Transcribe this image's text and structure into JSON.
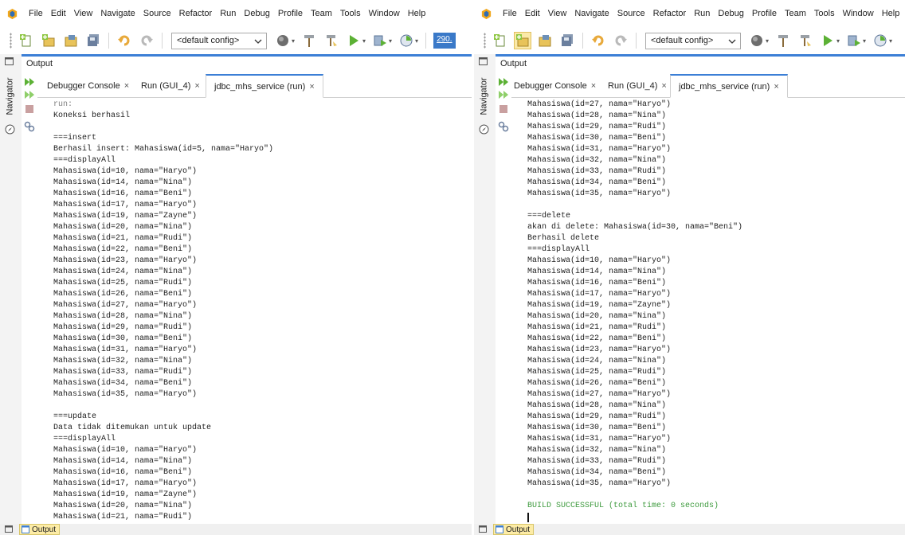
{
  "menubar": {
    "items": [
      "File",
      "Edit",
      "View",
      "Navigate",
      "Source",
      "Refactor",
      "Run",
      "Debug",
      "Profile",
      "Team",
      "Tools",
      "Window",
      "Help"
    ]
  },
  "toolbar": {
    "config_select": "<default config>",
    "memory_label": "290."
  },
  "sidebar": {
    "navigator_label": "Navigator"
  },
  "output": {
    "title": "Output"
  },
  "tabs": {
    "debugger_console": "Debugger Console",
    "run_gui": "Run (GUI_4)",
    "jdbc_service": "jdbc_mhs_service (run)",
    "close_glyph": "×"
  },
  "statusbar": {
    "output_label": "Output"
  },
  "left_console": [
    "run:",
    "Koneksi berhasil",
    "",
    "===insert",
    "Berhasil insert: Mahasiswa(id=5, nama=\"Haryo\")",
    "===displayAll",
    "Mahasiswa(id=10, nama=\"Haryo\")",
    "Mahasiswa(id=14, nama=\"Nina\")",
    "Mahasiswa(id=16, nama=\"Beni\")",
    "Mahasiswa(id=17, nama=\"Haryo\")",
    "Mahasiswa(id=19, nama=\"Zayne\")",
    "Mahasiswa(id=20, nama=\"Nina\")",
    "Mahasiswa(id=21, nama=\"Rudi\")",
    "Mahasiswa(id=22, nama=\"Beni\")",
    "Mahasiswa(id=23, nama=\"Haryo\")",
    "Mahasiswa(id=24, nama=\"Nina\")",
    "Mahasiswa(id=25, nama=\"Rudi\")",
    "Mahasiswa(id=26, nama=\"Beni\")",
    "Mahasiswa(id=27, nama=\"Haryo\")",
    "Mahasiswa(id=28, nama=\"Nina\")",
    "Mahasiswa(id=29, nama=\"Rudi\")",
    "Mahasiswa(id=30, nama=\"Beni\")",
    "Mahasiswa(id=31, nama=\"Haryo\")",
    "Mahasiswa(id=32, nama=\"Nina\")",
    "Mahasiswa(id=33, nama=\"Rudi\")",
    "Mahasiswa(id=34, nama=\"Beni\")",
    "Mahasiswa(id=35, nama=\"Haryo\")",
    "",
    "===update",
    "Data tidak ditemukan untuk update",
    "===displayAll",
    "Mahasiswa(id=10, nama=\"Haryo\")",
    "Mahasiswa(id=14, nama=\"Nina\")",
    "Mahasiswa(id=16, nama=\"Beni\")",
    "Mahasiswa(id=17, nama=\"Haryo\")",
    "Mahasiswa(id=19, nama=\"Zayne\")",
    "Mahasiswa(id=20, nama=\"Nina\")",
    "Mahasiswa(id=21, nama=\"Rudi\")"
  ],
  "right_console": [
    "Mahasiswa(id=27, nama=\"Haryo\")",
    "Mahasiswa(id=28, nama=\"Nina\")",
    "Mahasiswa(id=29, nama=\"Rudi\")",
    "Mahasiswa(id=30, nama=\"Beni\")",
    "Mahasiswa(id=31, nama=\"Haryo\")",
    "Mahasiswa(id=32, nama=\"Nina\")",
    "Mahasiswa(id=33, nama=\"Rudi\")",
    "Mahasiswa(id=34, nama=\"Beni\")",
    "Mahasiswa(id=35, nama=\"Haryo\")",
    "",
    "===delete",
    "akan di delete: Mahasiswa(id=30, nama=\"Beni\")",
    "Berhasil delete",
    "===displayAll",
    "Mahasiswa(id=10, nama=\"Haryo\")",
    "Mahasiswa(id=14, nama=\"Nina\")",
    "Mahasiswa(id=16, nama=\"Beni\")",
    "Mahasiswa(id=17, nama=\"Haryo\")",
    "Mahasiswa(id=19, nama=\"Zayne\")",
    "Mahasiswa(id=20, nama=\"Nina\")",
    "Mahasiswa(id=21, nama=\"Rudi\")",
    "Mahasiswa(id=22, nama=\"Beni\")",
    "Mahasiswa(id=23, nama=\"Haryo\")",
    "Mahasiswa(id=24, nama=\"Nina\")",
    "Mahasiswa(id=25, nama=\"Rudi\")",
    "Mahasiswa(id=26, nama=\"Beni\")",
    "Mahasiswa(id=27, nama=\"Haryo\")",
    "Mahasiswa(id=28, nama=\"Nina\")",
    "Mahasiswa(id=29, nama=\"Rudi\")",
    "Mahasiswa(id=30, nama=\"Beni\")",
    "Mahasiswa(id=31, nama=\"Haryo\")",
    "Mahasiswa(id=32, nama=\"Nina\")",
    "Mahasiswa(id=33, nama=\"Rudi\")",
    "Mahasiswa(id=34, nama=\"Beni\")",
    "Mahasiswa(id=35, nama=\"Haryo\")",
    "",
    "BUILD SUCCESSFUL (total time: 0 seconds)"
  ],
  "colors": {
    "accent_blue": "#3c7fd6",
    "build_success_green": "#3d9a3d",
    "run_gray": "#808080",
    "status_tab_yellow": "#fdeca6"
  },
  "icons": [
    "netbeans-logo-icon",
    "new-file-icon",
    "new-project-icon",
    "open-project-icon",
    "save-all-icon",
    "undo-icon",
    "redo-icon",
    "chevron-down-icon",
    "globe-icon",
    "hammer-icon",
    "clean-build-icon",
    "run-icon",
    "debug-icon",
    "profile-icon",
    "rerun-icon",
    "stop-icon",
    "settings-icon",
    "navigator-icon",
    "restore-window-icon",
    "output-window-icon"
  ]
}
